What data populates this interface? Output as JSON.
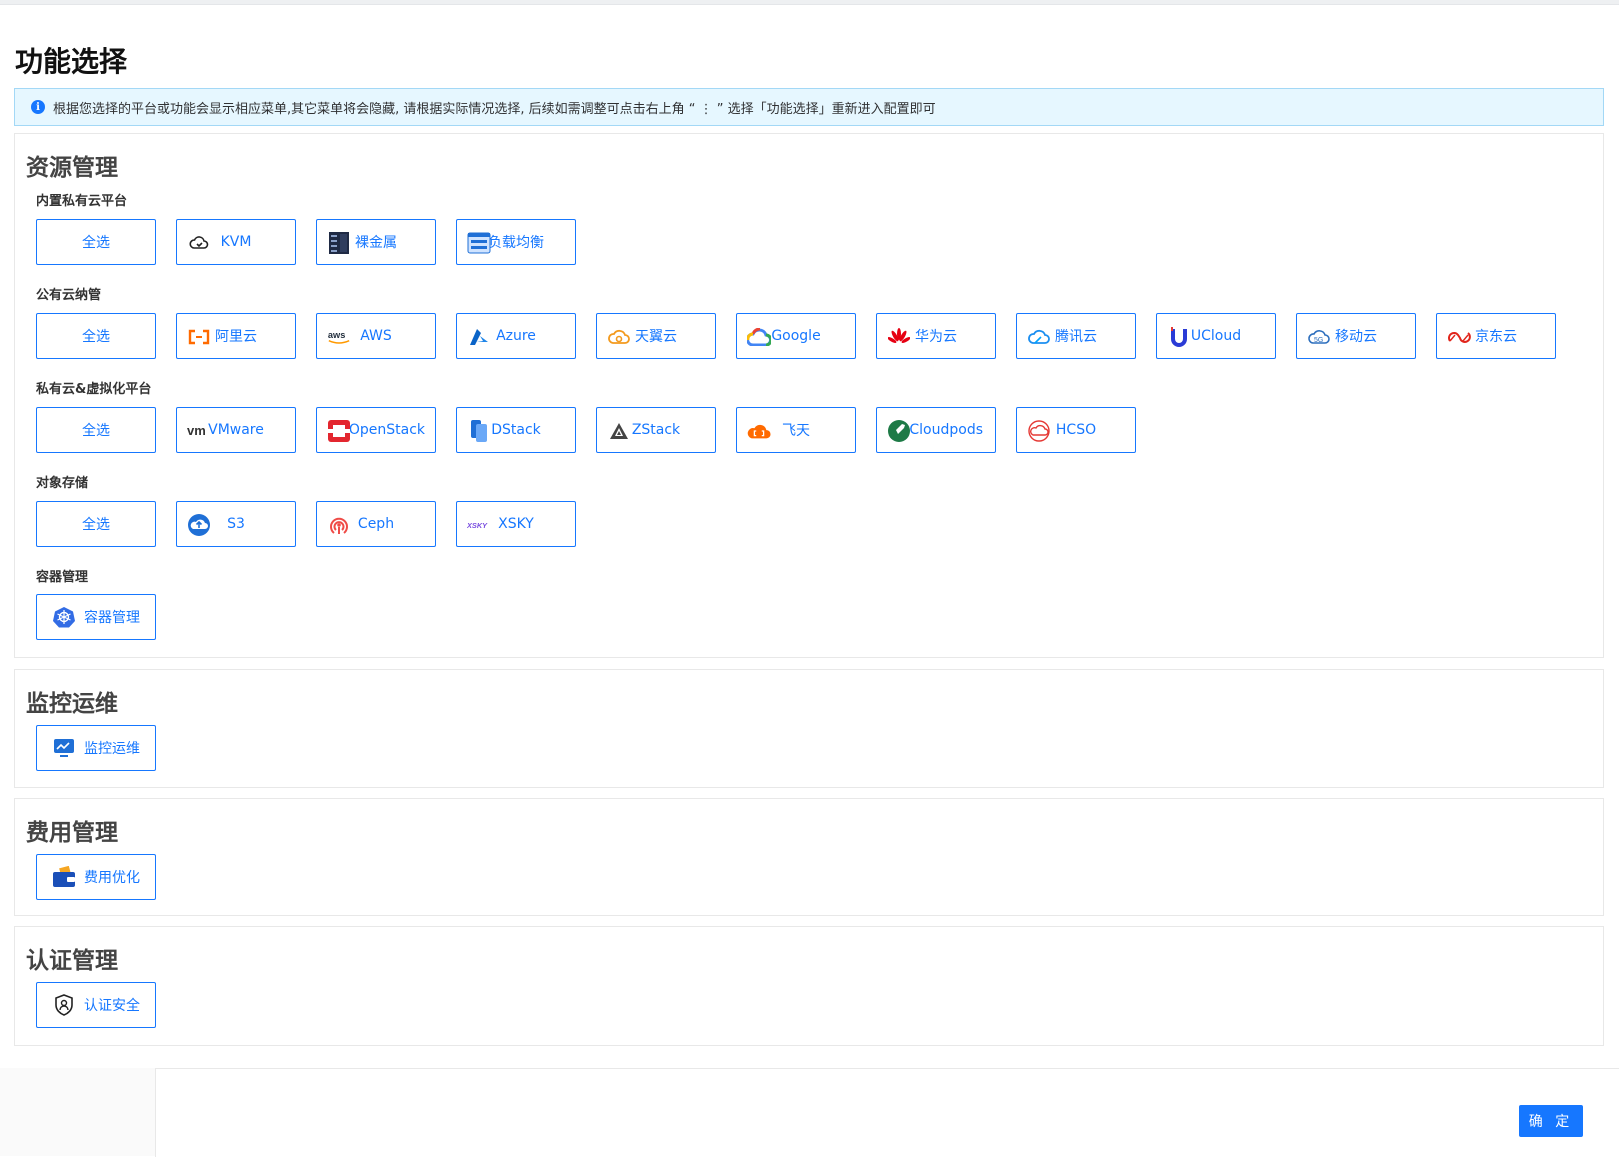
{
  "page_title": "功能选择",
  "info": {
    "icon": "info-icon",
    "text": "根据您选择的平台或功能会显示相应菜单,其它菜单将会隐藏, 请根据实际情况选择, 后续如需调整可点击右上角 “ ⋮ ” 选择「功能选择」重新进入配置即可"
  },
  "sections": {
    "resource": {
      "title": "资源管理",
      "groups": {
        "builtin": {
          "label": "内置私有云平台",
          "items": [
            "全选",
            "KVM",
            "裸金属",
            "负载均衡"
          ]
        },
        "public": {
          "label": "公有云纳管",
          "items": [
            "全选",
            "阿里云",
            "AWS",
            "Azure",
            "天翼云",
            "Google",
            "华为云",
            "腾讯云",
            "UCloud",
            "移动云",
            "京东云"
          ]
        },
        "private": {
          "label": "私有云&虚拟化平台",
          "items": [
            "全选",
            "VMware",
            "OpenStack",
            "DStack",
            "ZStack",
            "飞天",
            "Cloudpods",
            "HCSO"
          ]
        },
        "storage": {
          "label": "对象存储",
          "items": [
            "全选",
            "S3",
            "Ceph",
            "XSKY"
          ]
        },
        "container": {
          "label": "容器管理",
          "items": [
            "容器管理"
          ]
        }
      }
    },
    "monitor": {
      "title": "监控运维",
      "items": [
        "监控运维"
      ]
    },
    "cost": {
      "title": "费用管理",
      "items": [
        "费用优化"
      ]
    },
    "auth": {
      "title": "认证管理",
      "items": [
        "认证安全"
      ]
    }
  },
  "icon_names": {
    "kvm": "kvm-cloud-icon",
    "baremetal": "server-rack-icon",
    "lb": "load-balancer-icon",
    "aliyun": "aliyun-icon",
    "aws": "aws-icon",
    "azure": "azure-icon",
    "ctyun": "ctyun-cloud-icon",
    "google": "google-cloud-icon",
    "huawei": "huawei-icon",
    "tencent": "tencent-cloud-icon",
    "ucloud": "ucloud-icon",
    "ecloud": "ecloud-icon",
    "jdcloud": "jdcloud-icon",
    "vmware": "vmware-icon",
    "openstack": "openstack-icon",
    "dstack": "dstack-icon",
    "zstack": "zstack-icon",
    "apsara": "apsara-icon",
    "cloudpods": "cloudpods-icon",
    "hcso": "hcso-icon",
    "s3": "s3-icon",
    "ceph": "ceph-icon",
    "xsky": "xsky-icon",
    "k8s": "kubernetes-icon",
    "monitor": "monitor-chart-icon",
    "wallet": "wallet-icon",
    "shield": "shield-user-icon"
  },
  "colors": {
    "primary": "#1677ff",
    "info_bg": "#e6f7ff",
    "info_border": "#a3d8f6"
  },
  "footer": {
    "ok_label": "确 定"
  }
}
